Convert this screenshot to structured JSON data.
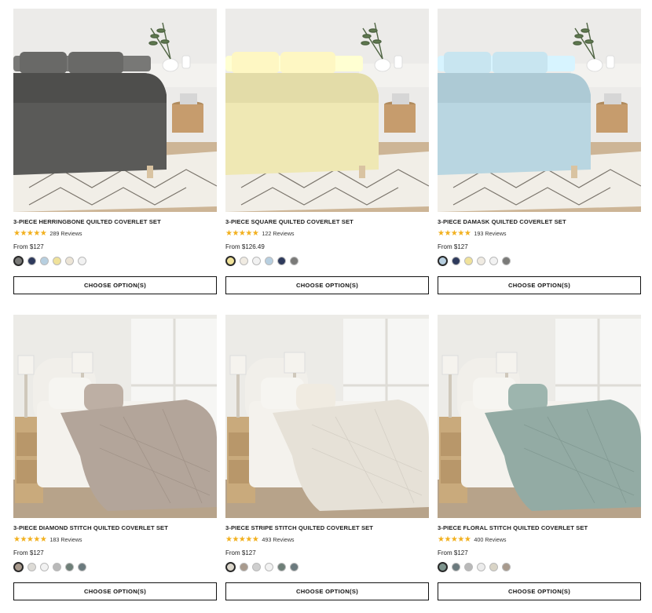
{
  "products": [
    {
      "title": "3-PIECE HERRINGBONE QUILTED COVERLET SET",
      "stars": "★★★★★",
      "reviews": "289 Reviews",
      "price": "From $127",
      "button": "CHOOSE OPTION(S)",
      "quilt_color": "#5a5a58",
      "swatches": [
        "#7a7a78",
        "#2e3a5c",
        "#b7cfe0",
        "#f0e29a",
        "#ede5d6",
        "#f2f2f2"
      ],
      "selected": 0
    },
    {
      "title": "3-PIECE SQUARE QUILTED COVERLET SET",
      "stars": "★★★★★",
      "reviews": "122 Reviews",
      "price": "From $126.49",
      "button": "CHOOSE OPTION(S)",
      "quilt_color": "#efe8b4",
      "swatches": [
        "#f0e29a",
        "#f0ebe2",
        "#f2f2f2",
        "#b7cfe0",
        "#2e3a5c",
        "#7a7a78"
      ],
      "selected": 0
    },
    {
      "title": "3-PIECE DAMASK QUILTED COVERLET SET",
      "stars": "★★★★★",
      "reviews": "193 Reviews",
      "price": "From $127",
      "button": "CHOOSE OPTION(S)",
      "quilt_color": "#b9d6e1",
      "swatches": [
        "#b7cfe0",
        "#2e3a5c",
        "#f0e29a",
        "#f0ebe2",
        "#f2f2f2",
        "#7a7a78"
      ],
      "selected": 0
    },
    {
      "title": "3-PIECE DIAMOND STITCH QUILTED COVERLET SET",
      "stars": "★★★★★",
      "reviews": "183 Reviews",
      "price": "From $127",
      "button": "CHOOSE OPTION(S)",
      "quilt_color": "#b3a59a",
      "swatches": [
        "#a89a8d",
        "#dddbd6",
        "#f2f2f2",
        "#b9b9b9",
        "#6e7f78",
        "#6b7a7e"
      ],
      "selected": 0
    },
    {
      "title": "3-PIECE STRIPE STITCH QUILTED COVERLET SET",
      "stars": "★★★★★",
      "reviews": "493 Reviews",
      "price": "From $127",
      "button": "CHOOSE OPTION(S)",
      "quilt_color": "#e6e1d7",
      "swatches": [
        "#dcd7cc",
        "#a89a8d",
        "#cfcfcf",
        "#f2f2f2",
        "#6e7f78",
        "#6b7a7e"
      ],
      "selected": 0
    },
    {
      "title": "3-PIECE FLORAL STITCH QUILTED COVERLET SET",
      "stars": "★★★★★",
      "reviews": "400 Reviews",
      "price": "From $127",
      "button": "CHOOSE OPTION(S)",
      "quilt_color": "#93aba4",
      "swatches": [
        "#7d948d",
        "#6b7a7e",
        "#b9b9b9",
        "#ececec",
        "#d9d4c6",
        "#a89a8d"
      ],
      "selected": 0
    }
  ]
}
